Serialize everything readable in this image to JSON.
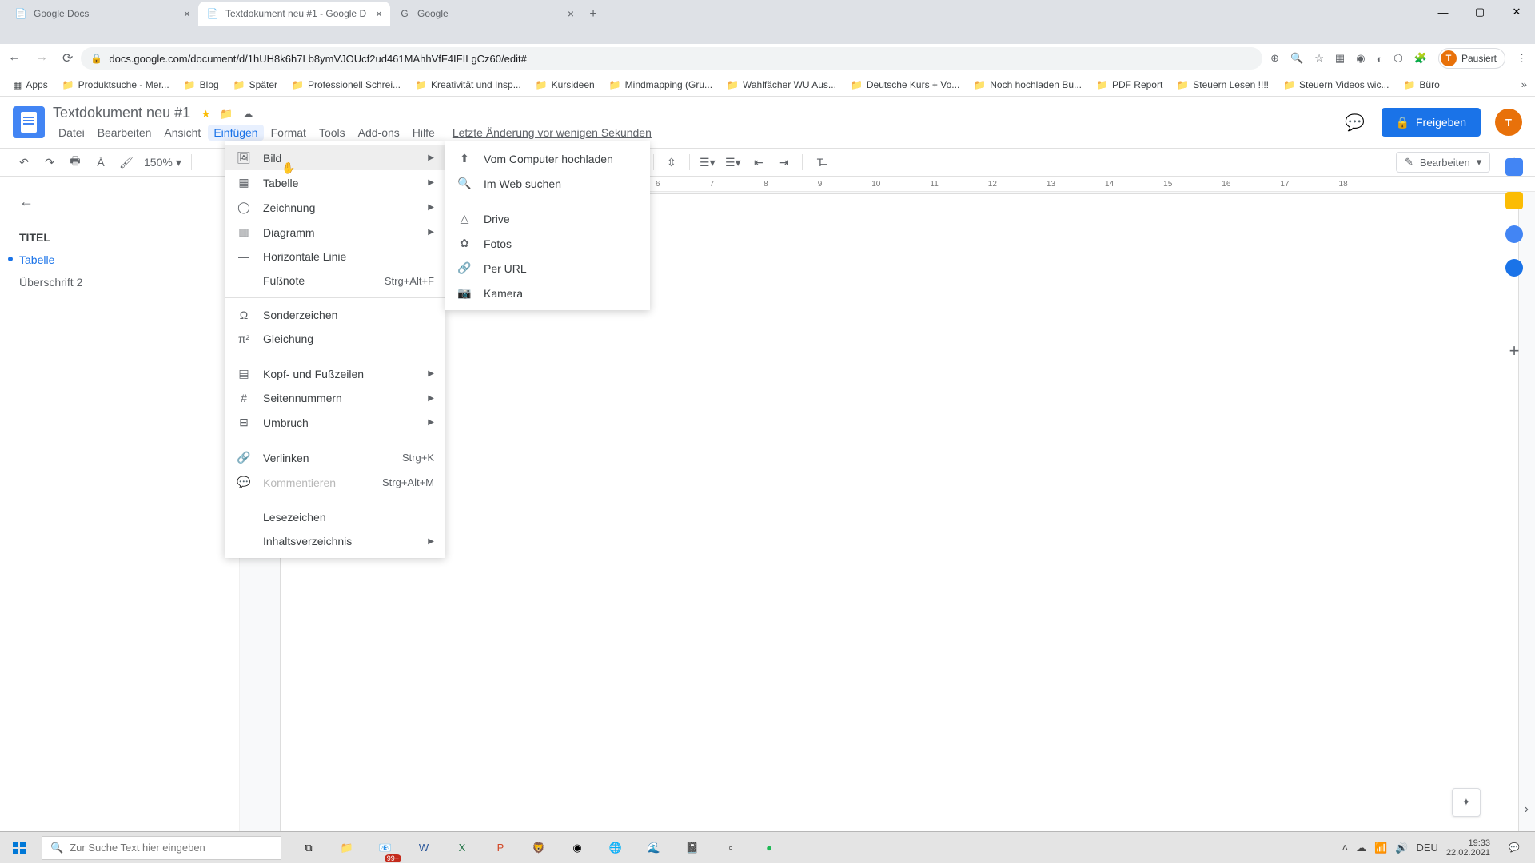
{
  "browser": {
    "tabs": [
      {
        "title": "Google Docs",
        "favicon": "docs"
      },
      {
        "title": "Textdokument neu #1 - Google D",
        "favicon": "docs"
      },
      {
        "title": "Google",
        "favicon": "google"
      }
    ],
    "url": "docs.google.com/document/d/1hUH8k6h7Lb8ymVJOUcf2ud461MAhhVfF4IFILgCz60/edit#",
    "pausiert": "Pausiert"
  },
  "bookmarks": [
    {
      "label": "Apps",
      "icon": "apps"
    },
    {
      "label": "Produktsuche - Mer...",
      "icon": "folder"
    },
    {
      "label": "Blog",
      "icon": "folder"
    },
    {
      "label": "Später",
      "icon": "folder"
    },
    {
      "label": "Professionell Schrei...",
      "icon": "folder"
    },
    {
      "label": "Kreativität und Insp...",
      "icon": "folder"
    },
    {
      "label": "Kursideen",
      "icon": "folder"
    },
    {
      "label": "Mindmapping  (Gru...",
      "icon": "folder"
    },
    {
      "label": "Wahlfächer WU Aus...",
      "icon": "folder"
    },
    {
      "label": "Deutsche Kurs + Vo...",
      "icon": "folder"
    },
    {
      "label": "Noch hochladen Bu...",
      "icon": "folder"
    },
    {
      "label": "PDF Report",
      "icon": "folder"
    },
    {
      "label": "Steuern Lesen !!!!",
      "icon": "folder"
    },
    {
      "label": "Steuern Videos wic...",
      "icon": "folder"
    },
    {
      "label": "Büro",
      "icon": "folder"
    }
  ],
  "doc": {
    "title": "Textdokument neu #1",
    "menubar": [
      "Datei",
      "Bearbeiten",
      "Ansicht",
      "Einfügen",
      "Format",
      "Tools",
      "Add-ons",
      "Hilfe"
    ],
    "active_menu": "Einfügen",
    "last_edit": "Letzte Änderung vor wenigen Sekunden",
    "share": "Freigeben",
    "edit_mode": "Bearbeiten",
    "zoom": "150%"
  },
  "outline": [
    {
      "text": "TITEL",
      "level": "title"
    },
    {
      "text": "Tabelle",
      "level": "active"
    },
    {
      "text": "Überschrift 2",
      "level": "h2"
    }
  ],
  "ruler": [
    "6",
    "7",
    "8",
    "9",
    "10",
    "11",
    "12",
    "13",
    "14",
    "15",
    "16",
    "17",
    "18"
  ],
  "insert_menu": [
    {
      "label": "Bild",
      "icon": "image",
      "arrow": true,
      "highlighted": true
    },
    {
      "label": "Tabelle",
      "icon": "table",
      "arrow": true
    },
    {
      "label": "Zeichnung",
      "icon": "draw",
      "arrow": true
    },
    {
      "label": "Diagramm",
      "icon": "chart",
      "arrow": true
    },
    {
      "label": "Horizontale Linie",
      "icon": "hline"
    },
    {
      "label": "Fußnote",
      "icon": "footnote",
      "shortcut": "Strg+Alt+F"
    },
    {
      "sep": true
    },
    {
      "label": "Sonderzeichen",
      "icon": "omega"
    },
    {
      "label": "Gleichung",
      "icon": "pi"
    },
    {
      "sep": true
    },
    {
      "label": "Kopf- und Fußzeilen",
      "icon": "header",
      "arrow": true
    },
    {
      "label": "Seitennummern",
      "icon": "pagenum",
      "arrow": true
    },
    {
      "label": "Umbruch",
      "icon": "break",
      "arrow": true
    },
    {
      "sep": true
    },
    {
      "label": "Verlinken",
      "icon": "link",
      "shortcut": "Strg+K"
    },
    {
      "label": "Kommentieren",
      "icon": "comment",
      "shortcut": "Strg+Alt+M",
      "disabled": true
    },
    {
      "sep": true
    },
    {
      "label": "Lesezeichen",
      "icon": "bookmark"
    },
    {
      "label": "Inhaltsverzeichnis",
      "icon": "toc",
      "arrow": true
    }
  ],
  "image_submenu": [
    {
      "label": "Vom Computer hochladen",
      "icon": "upload"
    },
    {
      "label": "Im Web suchen",
      "icon": "search"
    },
    {
      "sep": true
    },
    {
      "label": "Drive",
      "icon": "drive"
    },
    {
      "label": "Fotos",
      "icon": "photos"
    },
    {
      "label": "Per URL",
      "icon": "url"
    },
    {
      "label": "Kamera",
      "icon": "camera"
    }
  ],
  "taskbar": {
    "search_placeholder": "Zur Suche Text hier eingeben",
    "time": "19:33",
    "date": "22.02.2021",
    "lang": "DEU",
    "badge": "99+"
  }
}
